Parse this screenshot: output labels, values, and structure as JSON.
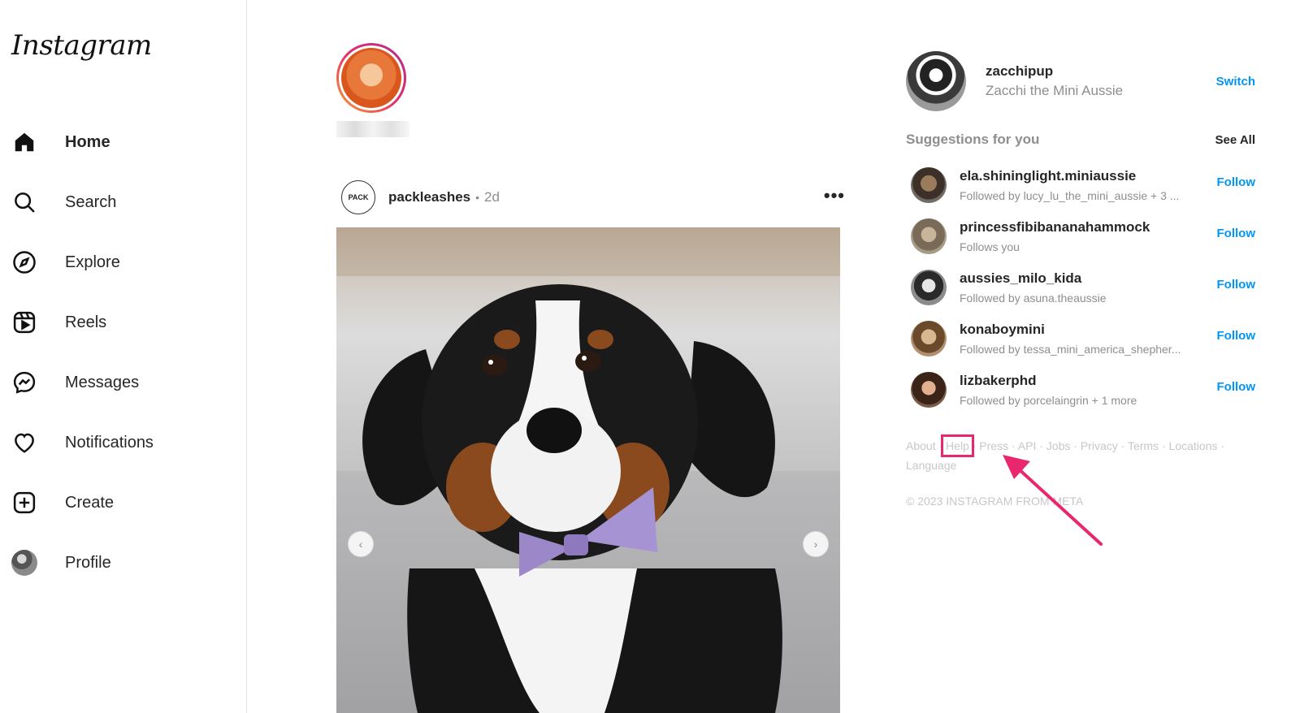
{
  "app": {
    "logo_text": "Instagram"
  },
  "sidebar": {
    "items": [
      {
        "label": "Home",
        "icon": "home-icon",
        "active": true
      },
      {
        "label": "Search",
        "icon": "search-icon"
      },
      {
        "label": "Explore",
        "icon": "compass-icon"
      },
      {
        "label": "Reels",
        "icon": "reels-icon"
      },
      {
        "label": "Messages",
        "icon": "messenger-icon"
      },
      {
        "label": "Notifications",
        "icon": "heart-icon"
      },
      {
        "label": "Create",
        "icon": "plus-square-icon"
      },
      {
        "label": "Profile",
        "icon": "avatar"
      }
    ]
  },
  "post": {
    "avatar_text": "PACK",
    "username": "packleashes",
    "separator": "•",
    "time": "2d",
    "more": "•••",
    "prev": "‹",
    "next": "›"
  },
  "account": {
    "username": "zacchipup",
    "name": "Zacchi the Mini Aussie",
    "switch_label": "Switch"
  },
  "suggestions": {
    "title": "Suggestions for you",
    "see_all": "See All",
    "follow_label": "Follow",
    "items": [
      {
        "username": "ela.shininglight.miniaussie",
        "subtitle": "Followed by lucy_lu_the_mini_aussie + 3 ..."
      },
      {
        "username": "princessfibibananahammock",
        "subtitle": "Follows you"
      },
      {
        "username": "aussies_milo_kida",
        "subtitle": "Followed by asuna.theaussie"
      },
      {
        "username": "konaboymini",
        "subtitle": "Followed by tessa_mini_america_shepher..."
      },
      {
        "username": "lizbakerphd",
        "subtitle": "Followed by porcelaingrin + 1 more"
      }
    ]
  },
  "footer": {
    "links": [
      "About",
      "Help",
      "Press",
      "API",
      "Jobs",
      "Privacy",
      "Terms",
      "Locations",
      "Language"
    ],
    "separator": " · ",
    "copyright": "© 2023 INSTAGRAM FROM META"
  },
  "colors": {
    "accent": "#0095f6",
    "annotation": "#e8276e"
  }
}
